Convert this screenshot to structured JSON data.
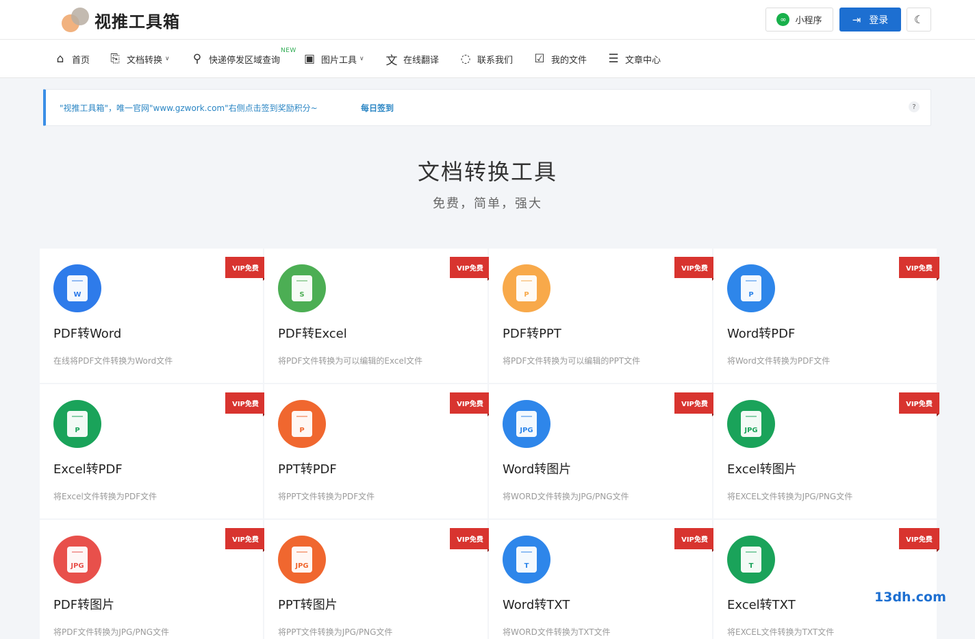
{
  "header": {
    "logo_text": "视推工具箱",
    "mini_program_label": "小程序",
    "mini_program_icon": "link-icon",
    "login_label": "登录",
    "login_icon": "login-arrow-icon",
    "theme_icon": "moon-icon"
  },
  "nav": {
    "items": [
      {
        "label": "首页",
        "icon": "home-icon"
      },
      {
        "label": "文档转换",
        "icon": "doc-convert-icon",
        "has_dropdown": true
      },
      {
        "label": "快递停发区域查询",
        "icon": "user-search-icon",
        "badge": "NEW"
      },
      {
        "label": "图片工具",
        "icon": "image-icon",
        "has_dropdown": true
      },
      {
        "label": "在线翻译",
        "icon": "translate-icon"
      },
      {
        "label": "联系我们",
        "icon": "chat-icon"
      },
      {
        "label": "我的文件",
        "icon": "file-check-icon"
      },
      {
        "label": "文章中心",
        "icon": "article-icon"
      }
    ]
  },
  "notice": {
    "text": "\"视推工具箱\"，唯一官网\"www.gzwork.com\"右侧点击签到奖励积分~",
    "link_label": "每日签到",
    "help": "?"
  },
  "hero": {
    "title": "文档转换工具",
    "subtitle": "免费，简单，强大"
  },
  "tools": [
    {
      "title": "PDF转Word",
      "desc": "在线将PDF文件转换为Word文件",
      "badge": "VIP免费",
      "color": "#2e7bea",
      "icon_mark": "W"
    },
    {
      "title": "PDF转Excel",
      "desc": "将PDF文件转换为可以编辑的Excel文件",
      "badge": "VIP免费",
      "color": "#4cae54",
      "icon_mark": "S"
    },
    {
      "title": "PDF转PPT",
      "desc": "将PDF文件转换为可以编辑的PPT文件",
      "badge": "VIP免费",
      "color": "#f8a94a",
      "icon_mark": "P"
    },
    {
      "title": "Word转PDF",
      "desc": "将Word文件转换为PDF文件",
      "badge": "VIP免费",
      "color": "#2e86ea",
      "icon_mark": "P"
    },
    {
      "title": "Excel转PDF",
      "desc": "将Excel文件转换为PDF文件",
      "badge": "VIP免费",
      "color": "#1aa35a",
      "icon_mark": "P"
    },
    {
      "title": "PPT转PDF",
      "desc": "将PPT文件转换为PDF文件",
      "badge": "VIP免费",
      "color": "#f0672f",
      "icon_mark": "P"
    },
    {
      "title": "Word转图片",
      "desc": "将WORD文件转换为JPG/PNG文件",
      "badge": "VIP免费",
      "color": "#2e86ea",
      "icon_mark": "JPG"
    },
    {
      "title": "Excel转图片",
      "desc": "将EXCEL文件转换为JPG/PNG文件",
      "badge": "VIP免费",
      "color": "#1aa35a",
      "icon_mark": "JPG"
    },
    {
      "title": "PDF转图片",
      "desc": "将PDF文件转换为JPG/PNG文件",
      "badge": "VIP免费",
      "color": "#e8504b",
      "icon_mark": "JPG"
    },
    {
      "title": "PPT转图片",
      "desc": "将PPT文件转换为JPG/PNG文件",
      "badge": "VIP免费",
      "color": "#f0672f",
      "icon_mark": "JPG"
    },
    {
      "title": "Word转TXT",
      "desc": "将WORD文件转换为TXT文件",
      "badge": "VIP免费",
      "color": "#2e86ea",
      "icon_mark": "T"
    },
    {
      "title": "Excel转TXT",
      "desc": "将EXCEL文件转换为TXT文件",
      "badge": "VIP免费",
      "color": "#1aa35a",
      "icon_mark": "T"
    }
  ],
  "watermark": "13dh.com"
}
